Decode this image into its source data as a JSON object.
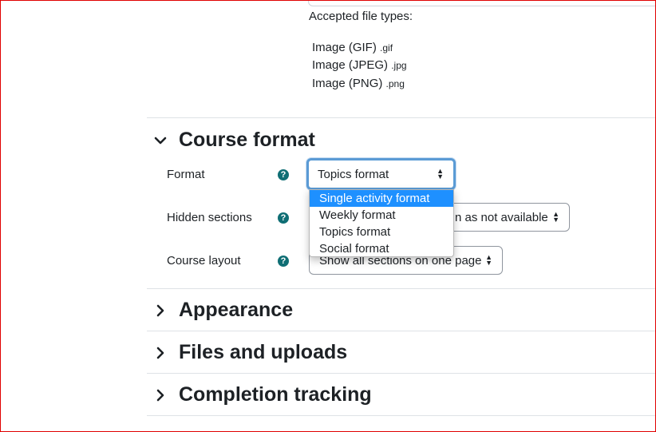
{
  "accepted_files": {
    "label": "Accepted file types:",
    "types": [
      {
        "name": "Image (GIF)",
        "ext": ".gif"
      },
      {
        "name": "Image (JPEG)",
        "ext": ".jpg"
      },
      {
        "name": "Image (PNG)",
        "ext": ".png"
      }
    ]
  },
  "course_format": {
    "title": "Course format",
    "format_label": "Format",
    "format_value": "Topics format",
    "format_options": [
      "Single activity format",
      "Weekly format",
      "Topics format",
      "Social format"
    ],
    "highlighted_option": "Single activity format",
    "hidden_sections_label": "Hidden sections",
    "hidden_sections_value": "Hidden sections are shown as not available",
    "hidden_sections_visible_text": "n as not available",
    "course_layout_label": "Course layout",
    "course_layout_value": "Show all sections on one page"
  },
  "sections": [
    {
      "title": "Appearance"
    },
    {
      "title": "Files and uploads"
    },
    {
      "title": "Completion tracking"
    }
  ],
  "colors": {
    "help_icon": "#0f6e74",
    "highlight": "#1e90ff",
    "focus_border": "#5b9bd5"
  }
}
